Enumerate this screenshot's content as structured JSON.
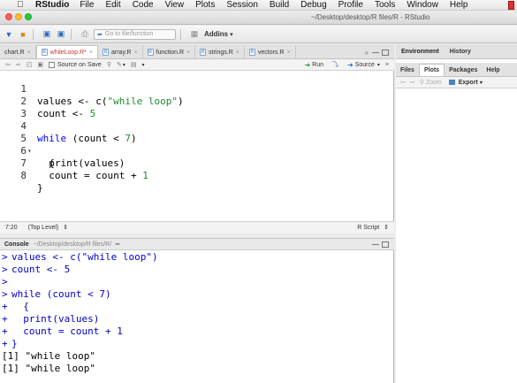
{
  "menubar": {
    "items": [
      "RStudio",
      "File",
      "Edit",
      "Code",
      "View",
      "Plots",
      "Session",
      "Build",
      "Debug",
      "Profile",
      "Tools",
      "Window",
      "Help"
    ]
  },
  "window": {
    "title": "~/Desktop/desktop/R files/R - RStudio"
  },
  "toolbar": {
    "goto_placeholder": "Go to file/function",
    "addins_label": "Addins"
  },
  "editor": {
    "tabs": [
      {
        "label": "chart.R",
        "active": false
      },
      {
        "label": "whileLoop.R*",
        "active": true
      },
      {
        "label": "array.R",
        "active": false
      },
      {
        "label": "function.R",
        "active": false
      },
      {
        "label": "strings.R",
        "active": false
      },
      {
        "label": "vectors.R",
        "active": false
      }
    ],
    "source_on_save": "Source on Save",
    "run_label": "Run",
    "source_label": "Source",
    "line_numbers": [
      "1",
      "2",
      "3",
      "4",
      "5",
      "6",
      "7",
      "8"
    ],
    "cursor_position": "7:20",
    "scope": "(Top Level)",
    "file_type": "R Script"
  },
  "console": {
    "title": "Console",
    "path": "~/Desktop/desktop/R files/R/",
    "lines": [
      {
        "prompt": ">",
        "text": "values <- c(\"while loop\")"
      },
      {
        "prompt": ">",
        "text": "count <- 5"
      },
      {
        "prompt": ">",
        "text": ""
      },
      {
        "prompt": ">",
        "text": "while (count < 7)"
      },
      {
        "prompt": "+",
        "text": "  {"
      },
      {
        "prompt": "+",
        "text": "  print(values)"
      },
      {
        "prompt": "+",
        "text": "  count = count + 1"
      },
      {
        "prompt": "+",
        "text": "}"
      }
    ],
    "output": [
      "[1] \"while loop\"",
      "[1] \"while loop\""
    ]
  },
  "right_top": {
    "tabs": [
      "Environment",
      "History"
    ]
  },
  "right_bottom": {
    "tabs": [
      "Files",
      "Plots",
      "Packages",
      "Help"
    ],
    "active_tab": "Plots",
    "zoom_label": "Zoom",
    "export_label": "Export"
  },
  "colors": {
    "string": "#1a8c2e",
    "keyword": "#0000ff",
    "active_tab_text": "#c0392b",
    "console_command": "#0000cc"
  }
}
